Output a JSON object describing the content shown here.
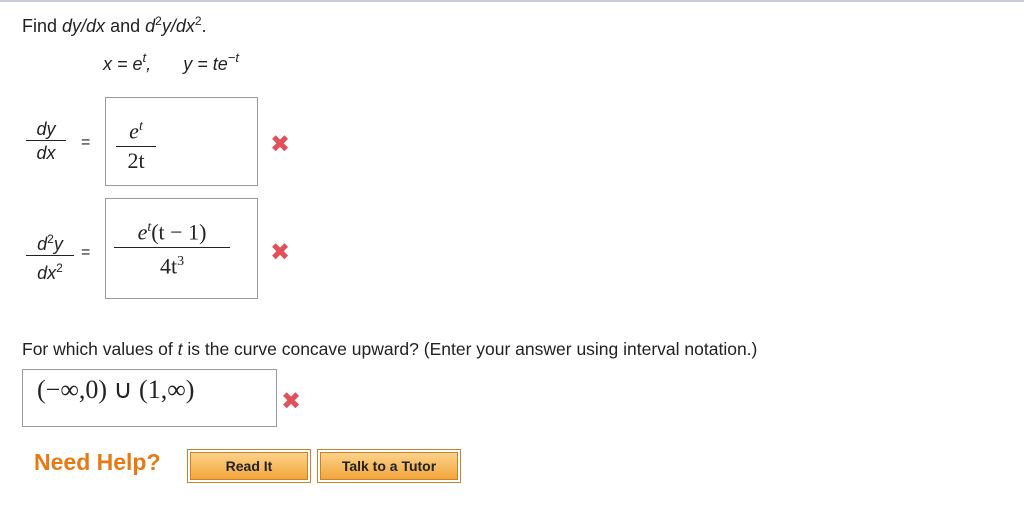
{
  "problem": {
    "prompt_prefix": "Find ",
    "prompt_expr1": "dy/dx",
    "prompt_and": " and ",
    "prompt_d": "d",
    "prompt_sup1": "2",
    "prompt_y": "y/dx",
    "prompt_sup2": "2",
    "prompt_end": ".",
    "eq_x": "x = e",
    "eq_x_exp": "t",
    "eq_sep": ",",
    "eq_y": "y = te",
    "eq_y_exp": "−t"
  },
  "first_derivative": {
    "label_num": "dy",
    "label_den": "dx",
    "equals": "=",
    "answer_num": "e",
    "answer_num_exp": "t",
    "answer_den": "2t",
    "status_icon": "x-icon"
  },
  "second_derivative": {
    "label_num_d": "d",
    "label_num_sup": "2",
    "label_num_y": "y",
    "label_den_dx": "dx",
    "label_den_sup": "2",
    "equals": "=",
    "answer_num_e": "e",
    "answer_num_exp": "t",
    "answer_num_rest": "(t − 1)",
    "answer_den": "4t",
    "answer_den_exp": "3",
    "status_icon": "x-icon"
  },
  "concavity": {
    "question_prefix": "For which values of ",
    "question_var": "t",
    "question_suffix": " is the curve concave upward? (Enter your answer using interval notation.)",
    "answer": "(−∞,0) ∪ (1,∞)",
    "status_icon": "x-icon"
  },
  "help": {
    "label": "Need Help?",
    "read_it": "Read It",
    "talk_to_tutor": "Talk to a Tutor"
  },
  "colors": {
    "wrong": "#e0515a",
    "help_label": "#e87a14",
    "button_fill": "#f3a63b"
  }
}
